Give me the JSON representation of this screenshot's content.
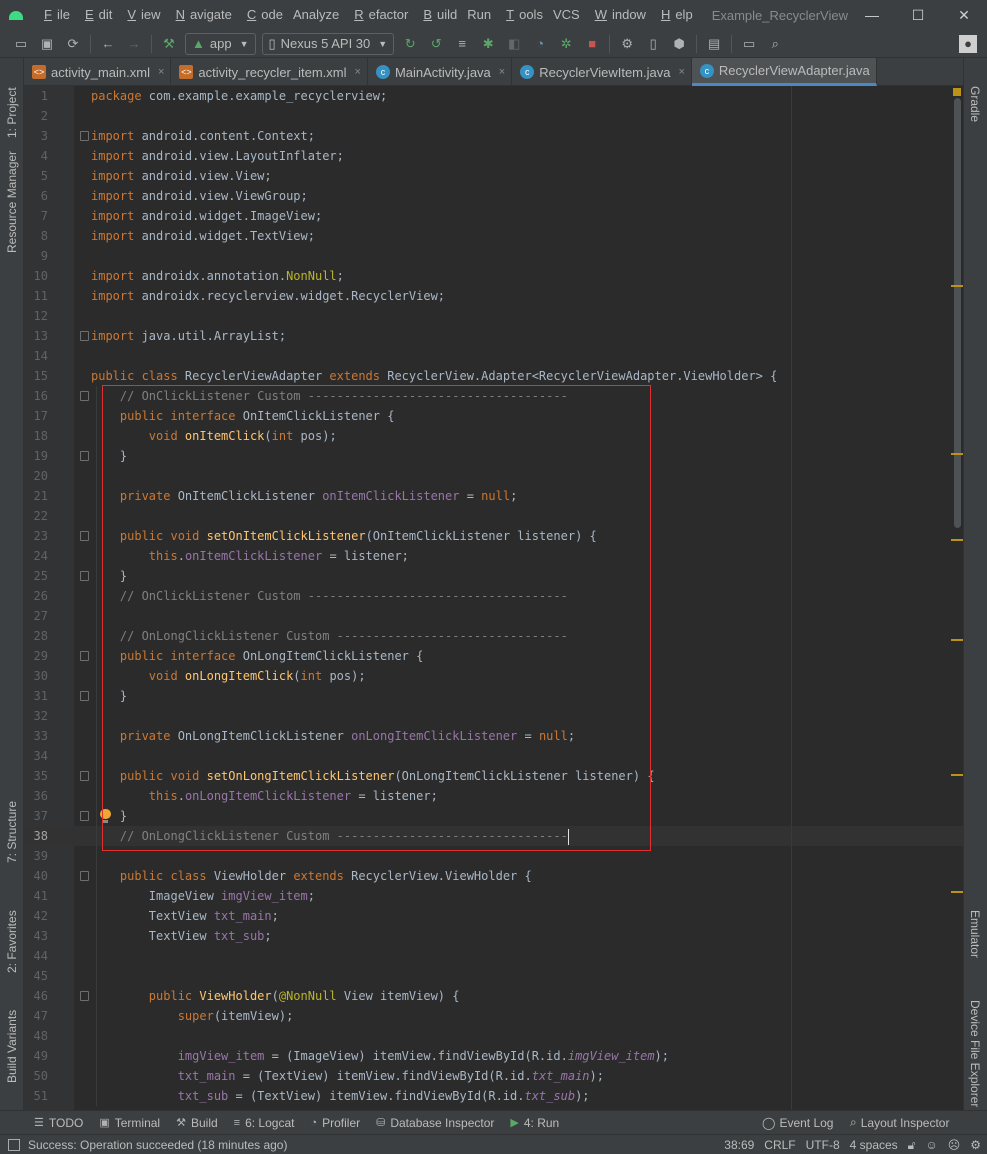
{
  "window": {
    "title": "Example_RecyclerView",
    "menu": [
      {
        "u": "F",
        "rest": "ile"
      },
      {
        "u": "E",
        "rest": "dit"
      },
      {
        "u": "V",
        "rest": "iew"
      },
      {
        "u": "N",
        "rest": "avigate"
      },
      {
        "u": "C",
        "rest": "ode"
      },
      {
        "u": "",
        "rest": "Analyze"
      },
      {
        "u": "R",
        "rest": "efactor"
      },
      {
        "u": "B",
        "rest": "uild"
      },
      {
        "u": "",
        "rest": "Run"
      },
      {
        "u": "T",
        "rest": "ools"
      },
      {
        "u": "",
        "rest": "VCS"
      },
      {
        "u": "W",
        "rest": "indow"
      },
      {
        "u": "H",
        "rest": "elp"
      }
    ],
    "controls": {
      "minimize": "—",
      "maximize": "☐",
      "close": "✕"
    }
  },
  "toolbar": {
    "run_config": "app",
    "device": "Nexus 5 API 30"
  },
  "tabs": [
    {
      "label": "activity_main.xml",
      "type": "xml"
    },
    {
      "label": "activity_recycler_item.xml",
      "type": "xml"
    },
    {
      "label": "MainActivity.java",
      "type": "java"
    },
    {
      "label": "RecyclerViewItem.java",
      "type": "java"
    },
    {
      "label": "RecyclerViewAdapter.java",
      "type": "java",
      "active": true
    }
  ],
  "left_tools": {
    "project": "1: Project",
    "resource_manager": "Resource Manager",
    "structure": "7: Structure",
    "favorites": "2: Favorites",
    "build_variants": "Build Variants"
  },
  "right_tools": {
    "gradle": "Gradle",
    "emulator": "Emulator",
    "device_explorer": "Device File Explorer"
  },
  "editor": {
    "current_line": 38,
    "lines": [
      {
        "n": "1",
        "html": "<span class=\"kw\">package </span>com.example.example_recyclerview;"
      },
      {
        "n": "2",
        "html": ""
      },
      {
        "n": "3",
        "html": "<span class=\"kw\">import </span>android.content.Context;",
        "fold": true
      },
      {
        "n": "4",
        "html": "<span class=\"kw\">import </span>android.view.LayoutInflater;"
      },
      {
        "n": "5",
        "html": "<span class=\"kw\">import </span>android.view.View;"
      },
      {
        "n": "6",
        "html": "<span class=\"kw\">import </span>android.view.ViewGroup;"
      },
      {
        "n": "7",
        "html": "<span class=\"kw\">import </span>android.widget.ImageView;"
      },
      {
        "n": "8",
        "html": "<span class=\"kw\">import </span>android.widget.TextView;"
      },
      {
        "n": "9",
        "html": ""
      },
      {
        "n": "10",
        "html": "<span class=\"kw\">import </span>androidx.annotation.<span class=\"ann\">NonNull</span>;"
      },
      {
        "n": "11",
        "html": "<span class=\"kw\">import </span>androidx.recyclerview.widget.RecyclerView;"
      },
      {
        "n": "12",
        "html": ""
      },
      {
        "n": "13",
        "html": "<span class=\"kw\">import </span>java.util.ArrayList;",
        "fold": true
      },
      {
        "n": "14",
        "html": ""
      },
      {
        "n": "15",
        "html": "<span class=\"kw\">public class </span>RecyclerViewAdapter <span class=\"kw\">extends </span>RecyclerView.Adapter&lt;RecyclerViewAdapter.ViewHolder&gt; {"
      },
      {
        "n": "16",
        "html": "    <span class=\"cm\">// OnClickListener Custom ------------------------------------</span>",
        "fold": true
      },
      {
        "n": "17",
        "html": "    <span class=\"kw\">public interface </span>OnItemClickListener {"
      },
      {
        "n": "18",
        "html": "        <span class=\"kw\">void </span><span class=\"mth\">onItemClick</span>(<span class=\"kw\">int </span>pos);"
      },
      {
        "n": "19",
        "html": "    }",
        "fold": true
      },
      {
        "n": "20",
        "html": ""
      },
      {
        "n": "21",
        "html": "    <span class=\"kw\">private </span>OnItemClickListener <span class=\"fld\">onItemClickListener </span>= <span class=\"kw\">null</span>;"
      },
      {
        "n": "22",
        "html": ""
      },
      {
        "n": "23",
        "html": "    <span class=\"kw\">public void </span><span class=\"mth\">setOnItemClickListener</span>(OnItemClickListener listener) {",
        "fold": true
      },
      {
        "n": "24",
        "html": "        <span class=\"kw\">this</span>.<span class=\"fld\">onItemClickListener </span>= listener;"
      },
      {
        "n": "25",
        "html": "    }",
        "fold": true
      },
      {
        "n": "26",
        "html": "    <span class=\"cm\">// OnClickListener Custom ------------------------------------</span>"
      },
      {
        "n": "27",
        "html": ""
      },
      {
        "n": "28",
        "html": "    <span class=\"cm\">// OnLongClickListener Custom --------------------------------</span>"
      },
      {
        "n": "29",
        "html": "    <span class=\"kw\">public interface </span>OnLongItemClickListener {",
        "fold": true
      },
      {
        "n": "30",
        "html": "        <span class=\"kw\">void </span><span class=\"mth\">onLongItemClick</span>(<span class=\"kw\">int </span>pos);"
      },
      {
        "n": "31",
        "html": "    }",
        "fold": true
      },
      {
        "n": "32",
        "html": ""
      },
      {
        "n": "33",
        "html": "    <span class=\"kw\">private </span>OnLongItemClickListener <span class=\"fld\">onLongItemClickListener </span>= <span class=\"kw\">null</span>;"
      },
      {
        "n": "34",
        "html": ""
      },
      {
        "n": "35",
        "html": "    <span class=\"kw\">public void </span><span class=\"mth\">setOnLongItemClickListener</span>(OnLongItemClickListener listener) {",
        "fold": true
      },
      {
        "n": "36",
        "html": "        <span class=\"kw\">this</span>.<span class=\"fld\">onLongItemClickListener </span>= listener;"
      },
      {
        "n": "37",
        "html": "    }",
        "fold": true,
        "bulb": true
      },
      {
        "n": "38",
        "html": "    <span class=\"cm\">// OnLongClickListener Custom --------------------------------</span><span class=\"cursor\"></span>"
      },
      {
        "n": "39",
        "html": ""
      },
      {
        "n": "40",
        "html": "    <span class=\"kw\">public class </span>ViewHolder <span class=\"kw\">extends </span>RecyclerView.ViewHolder {",
        "fold": true
      },
      {
        "n": "41",
        "html": "        ImageView <span class=\"fld\">imgView_item</span>;"
      },
      {
        "n": "42",
        "html": "        TextView <span class=\"fld\">txt_main</span>;"
      },
      {
        "n": "43",
        "html": "        TextView <span class=\"fld\">txt_sub</span>;"
      },
      {
        "n": "44",
        "html": ""
      },
      {
        "n": "45",
        "html": ""
      },
      {
        "n": "46",
        "html": "        <span class=\"kw\">public </span><span class=\"mth\">ViewHolder</span>(<span class=\"ann\">@NonNull </span>View itemView) {",
        "fold": true
      },
      {
        "n": "47",
        "html": "            <span class=\"kw\">super</span>(itemView);"
      },
      {
        "n": "48",
        "html": ""
      },
      {
        "n": "49",
        "html": "            <span class=\"fld\">imgView_item </span>= (ImageView) itemView.findViewById(R.id.<span class=\"fldi\">imgView_item</span>);"
      },
      {
        "n": "50",
        "html": "            <span class=\"fld\">txt_main </span>= (TextView) itemView.findViewById(R.id.<span class=\"fldi\">txt_main</span>);"
      },
      {
        "n": "51",
        "html": "            <span class=\"fld\">txt_sub </span>= (TextView) itemView.findViewById(R.id.<span class=\"fldi\">txt_sub</span>);"
      }
    ]
  },
  "bottom_tools": {
    "todo": "TODO",
    "terminal": "Terminal",
    "build": "Build",
    "logcat": "6: Logcat",
    "profiler": "Profiler",
    "database": "Database Inspector",
    "run": "4: Run",
    "event_log": "Event Log",
    "layout_inspector": "Layout Inspector"
  },
  "status": {
    "message": "Success: Operation succeeded (18 minutes ago)",
    "position": "38:69",
    "line_sep": "CRLF",
    "encoding": "UTF-8",
    "indent": "4 spaces"
  }
}
